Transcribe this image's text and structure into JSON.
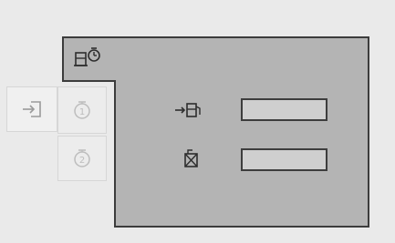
{
  "panel": {
    "fill_color": "#b4b4b4",
    "border_color": "#3c3c3c",
    "background_color": "#eaeaea"
  },
  "header": {
    "icon": "fuel-timer-icon"
  },
  "sidebar": {
    "items": [
      {
        "icon": "exit-icon"
      },
      {
        "icon": "timer-1-icon"
      },
      {
        "icon": "timer-2-icon"
      }
    ]
  },
  "rows": [
    {
      "icon": "fuel-refill-icon",
      "value": ""
    },
    {
      "icon": "fuel-empty-icon",
      "value": ""
    }
  ]
}
